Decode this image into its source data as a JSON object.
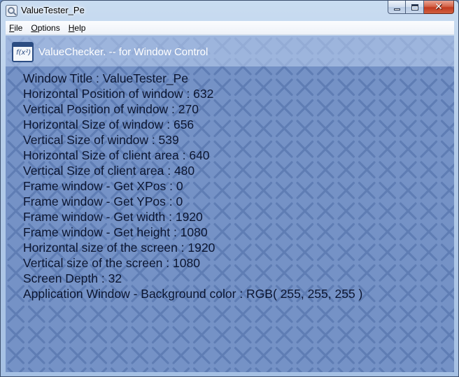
{
  "window": {
    "title": "ValueTester_Pe"
  },
  "menu": [
    {
      "accel": "F",
      "rest": "ile"
    },
    {
      "accel": "O",
      "rest": "ptions"
    },
    {
      "accel": "H",
      "rest": "elp"
    }
  ],
  "header": {
    "title": "ValueChecker. -- for Window Control"
  },
  "lines": [
    "Window Title : ValueTester_Pe",
    "Horizontal Position of window : 632",
    "Vertical Position of window : 270",
    "Horizontal Size of window : 656",
    "Vertical Size of window : 539",
    "Horizontal Size of client area : 640",
    "Vertical Size of client area : 480",
    "Frame window - Get XPos : 0",
    "Frame window - Get YPos : 0",
    "Frame window - Get width : 1920",
    "Frame window - Get height : 1080",
    "Horizontal size of the screen : 1920",
    "Vertical size of the screen : 1080",
    "Screen Depth : 32",
    "Application Window - Background color : RGB( 255, 255, 255 )"
  ],
  "icons": {
    "app": "magnifier-icon",
    "header": "formula-window-icon",
    "minimize": "minimize-icon",
    "maximize": "maximize-icon",
    "close": "close-icon"
  },
  "colors": {
    "client_background": "#7592c6",
    "pattern": "#5f7db4",
    "value_text": "#0b1530",
    "header_text": "#ffffff"
  }
}
